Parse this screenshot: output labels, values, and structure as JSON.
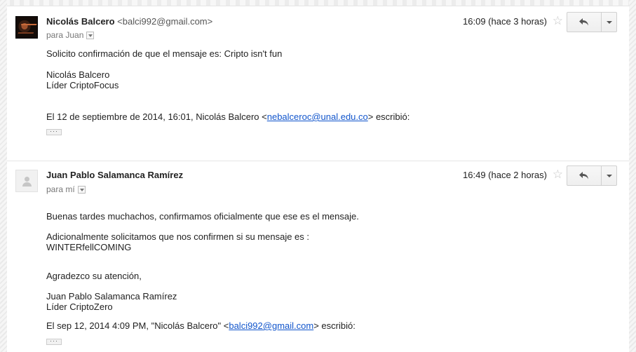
{
  "messages": [
    {
      "sender_name": "Nicolás Balcero",
      "sender_email": "<balci992@gmail.com>",
      "to": "para Juan",
      "time": "16:09 (hace 3 horas)",
      "lines": [
        "Solicito confirmación de que el mensaje es: Cripto isn't fun",
        "Nicolás Balcero",
        "Líder CriptoFocus"
      ],
      "quote_prefix": "El 12 de septiembre de 2014, 16:01, Nicolás Balcero <",
      "quote_link": "nebalceroc@unal.edu.co",
      "quote_suffix": "> escribió:",
      "show_trimmed": "···"
    },
    {
      "sender_name": "Juan Pablo Salamanca Ramírez",
      "sender_email": "",
      "to": "para mí",
      "time": "16:49 (hace 2 horas)",
      "lines": [
        "Buenas tardes muchachos, confirmamos oficialmente que ese es el mensaje.",
        "Adicionalmente solicitamos que nos confirmen si su mensaje es :",
        "WINTERfellCOMING",
        "Agradezco su atención,",
        "Juan Pablo Salamanca Ramírez",
        "Líder CriptoZero"
      ],
      "quote_prefix": "El sep 12, 2014 4:09 PM, \"Nicolás Balcero\" <",
      "quote_link": "balci992@gmail.com",
      "quote_suffix": "> escribió:",
      "show_trimmed": "···"
    }
  ],
  "icons": {
    "star": "☆",
    "reply": "reply-arrow",
    "more": "chevron-down"
  }
}
